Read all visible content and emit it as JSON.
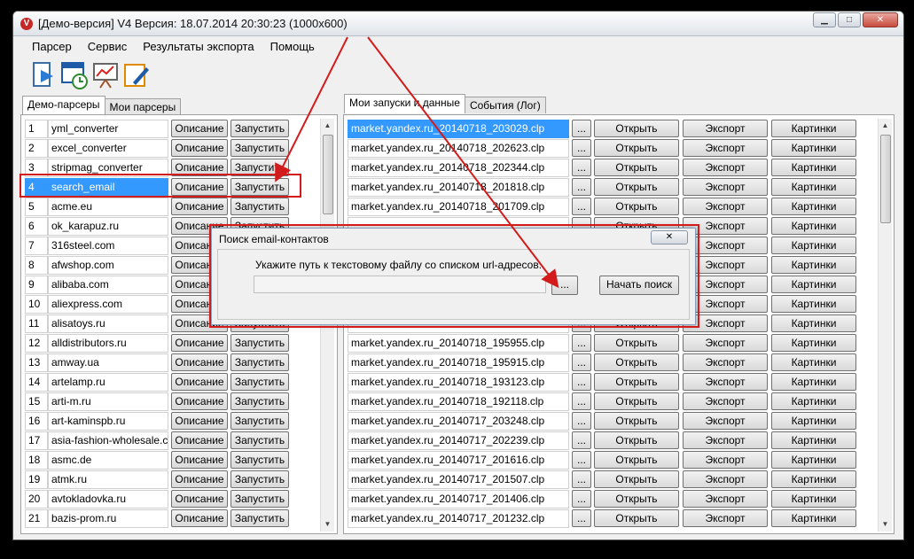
{
  "window": {
    "title": "[Демо-версия] V4  Версия: 18.07.2014 20:30:23 (1000x600)",
    "app_icon": "V",
    "min_icon": "minimize-icon",
    "max_icon": "maximize-icon",
    "close_icon": "close-icon"
  },
  "menu": [
    "Парсер",
    "Сервис",
    "Результаты экспорта",
    "Помощь"
  ],
  "toolbar": [
    "document-arrow-icon",
    "calendar-clock-icon",
    "chart-presentation-icon",
    "edit-pencil-icon"
  ],
  "left_tabs": [
    "Демо-парсеры",
    "Мои парсеры"
  ],
  "right_tabs": [
    "Мои запуски и данные",
    "События (Лог)"
  ],
  "left_buttons": {
    "describe": "Описание",
    "run": "Запустить"
  },
  "parsers": [
    {
      "num": "1",
      "name": "yml_converter"
    },
    {
      "num": "2",
      "name": "excel_converter"
    },
    {
      "num": "3",
      "name": "stripmag_converter"
    },
    {
      "num": "4",
      "name": "search_email"
    },
    {
      "num": "5",
      "name": "acme.eu"
    },
    {
      "num": "6",
      "name": "ok_karapuz.ru"
    },
    {
      "num": "7",
      "name": "316steel.com"
    },
    {
      "num": "8",
      "name": "afwshop.com"
    },
    {
      "num": "9",
      "name": "alibaba.com"
    },
    {
      "num": "10",
      "name": "aliexpress.com"
    },
    {
      "num": "11",
      "name": "alisatoys.ru"
    },
    {
      "num": "12",
      "name": "alldistributors.ru"
    },
    {
      "num": "13",
      "name": "amway.ua"
    },
    {
      "num": "14",
      "name": "artelamp.ru"
    },
    {
      "num": "15",
      "name": "arti-m.ru"
    },
    {
      "num": "16",
      "name": "art-kaminspb.ru"
    },
    {
      "num": "17",
      "name": "asia-fashion-wholesale.com"
    },
    {
      "num": "18",
      "name": "asmc.de"
    },
    {
      "num": "19",
      "name": "atmk.ru"
    },
    {
      "num": "20",
      "name": "avtokladovka.ru"
    },
    {
      "num": "21",
      "name": "bazis-prom.ru"
    }
  ],
  "right_buttons": {
    "dots": "...",
    "open": "Открыть",
    "export": "Экспорт",
    "pictures": "Картинки"
  },
  "runs": [
    "market.yandex.ru_20140718_203029.clp",
    "market.yandex.ru_20140718_202623.clp",
    "market.yandex.ru_20140718_202344.clp",
    "market.yandex.ru_20140718_201818.clp",
    "market.yandex.ru_20140718_201709.clp",
    "",
    "",
    "",
    "",
    "",
    "",
    "market.yandex.ru_20140718_195955.clp",
    "market.yandex.ru_20140718_195915.clp",
    "market.yandex.ru_20140718_193123.clp",
    "market.yandex.ru_20140718_192118.clp",
    "market.yandex.ru_20140717_203248.clp",
    "market.yandex.ru_20140717_202239.clp",
    "market.yandex.ru_20140717_201616.clp",
    "market.yandex.ru_20140717_201507.clp",
    "market.yandex.ru_20140717_201406.clp",
    "market.yandex.ru_20140717_201232.clp"
  ],
  "dialog": {
    "title": "Поиск email-контактов",
    "label": "Укажите путь к текстовому файлу со списком url-адресов:",
    "path_value": "",
    "browse": "...",
    "start": "Начать поиск",
    "close_icon": "close-icon"
  },
  "annotation_color": "#d41b1b"
}
